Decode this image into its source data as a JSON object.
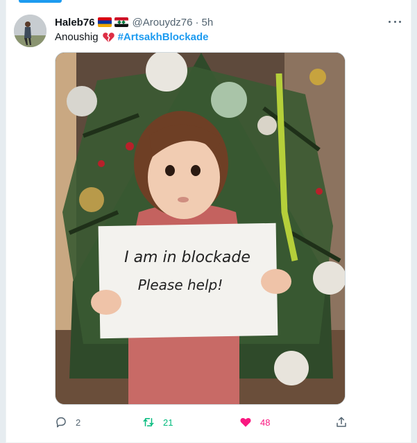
{
  "tweet": {
    "author": {
      "display_name": "Haleb76",
      "flags": [
        "flag-armenia-icon",
        "flag-syria-icon"
      ],
      "handle": "@Arouydz76",
      "separator": "·",
      "time": "5h"
    },
    "text": {
      "name": "Anoushig",
      "emoji": "broken-heart-icon",
      "hashtag": "#ArtsakhBlockade"
    },
    "media": {
      "sign_line_1": "I am in blockade",
      "sign_line_2": "Please help!"
    },
    "stats": {
      "replies": "2",
      "retweets": "21",
      "likes": "48"
    }
  },
  "colors": {
    "accent": "#1d9bf0",
    "retweet": "#00ba7c",
    "like": "#f91880",
    "muted": "#536471"
  }
}
